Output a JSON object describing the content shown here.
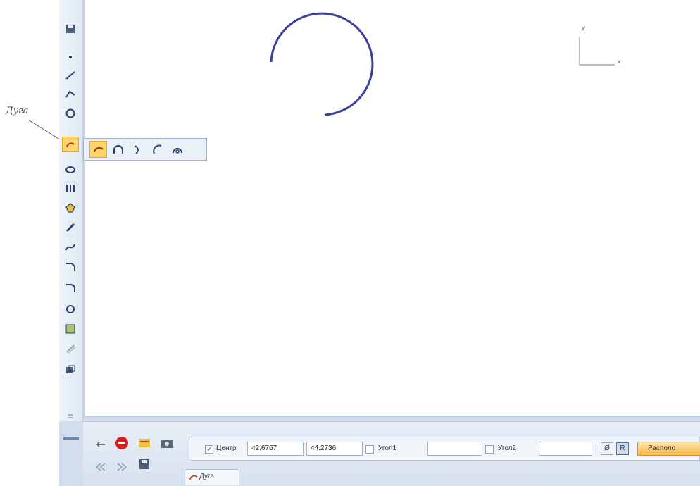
{
  "callout": {
    "label": "Дуга"
  },
  "axes": {
    "y_label": "y",
    "x_label": "x"
  },
  "toolbar": {
    "tools": [
      "save-icon",
      "point-icon",
      "line-icon",
      "polyline-icon",
      "circle-icon",
      "arc-icon",
      "ellipse-icon",
      "auxiliary-curves-icon",
      "polygon-icon",
      "segment-icon",
      "bezier-icon",
      "chamfer-icon",
      "fillet-icon",
      "contour-icon",
      "hatch-icon",
      "offset-icon",
      "equidistant-icon",
      "scroll-icon"
    ],
    "active_tool": "arc-icon"
  },
  "flyout": {
    "items": [
      "arc-center-icon",
      "arc-3-points-icon",
      "arc-tangent-icon",
      "arc-2-points-icon",
      "arc-semicircle-icon"
    ],
    "active_item": "arc-center-icon"
  },
  "properties": {
    "center_label": "Центр",
    "center_x": "42.6767",
    "center_y": "44.2736",
    "point1_label": "Угол1",
    "point2_label": "Угол2",
    "diameter_symbol": "Ø",
    "radius_symbol": "R",
    "direction_label": "Располо",
    "tab_label": "Дуга"
  },
  "colors": {
    "arc": "#3b3f9e",
    "active": "#ffd66b",
    "panel": "#dfe8f3"
  }
}
